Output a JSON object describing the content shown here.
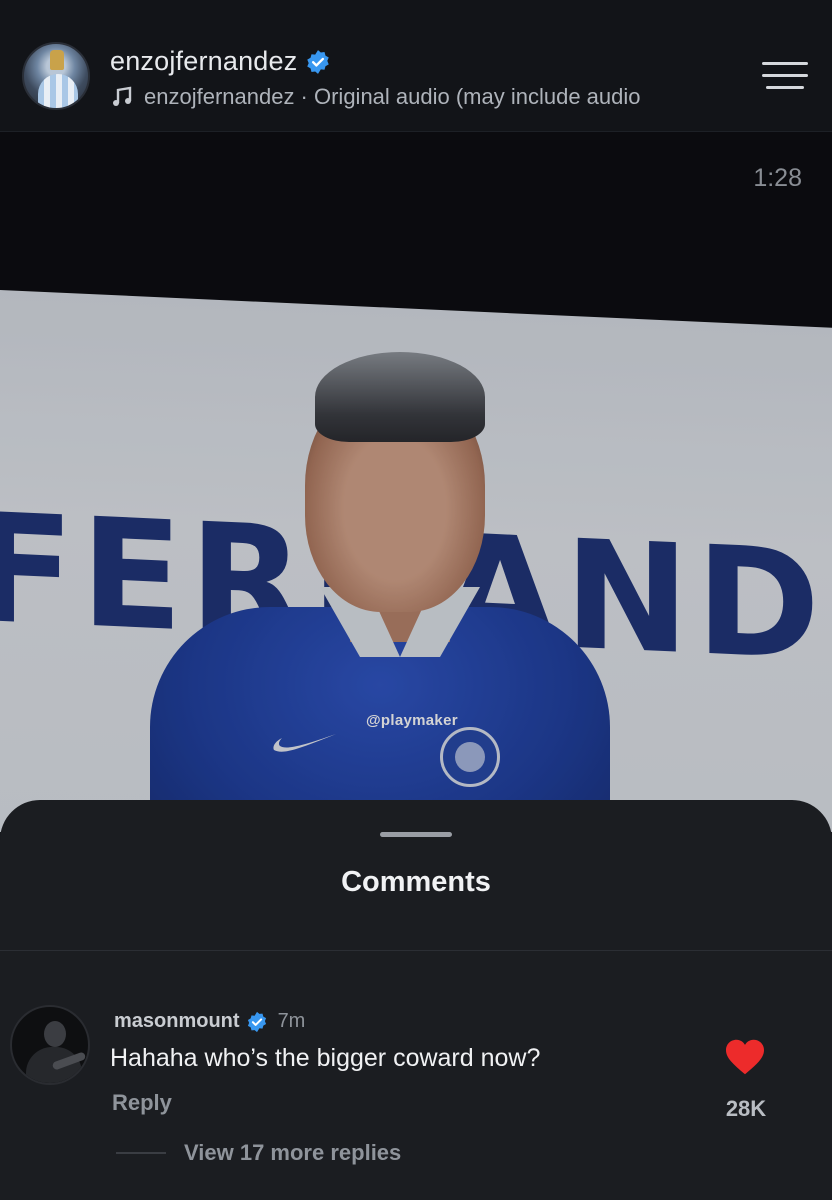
{
  "header": {
    "username": "enzojfernandez",
    "audio_text": "enzojfernandez · Original audio  (may include audio",
    "icons": {
      "verified": "verified-badge-icon",
      "audio": "music-note-icon",
      "menu": "menu-icon"
    }
  },
  "video": {
    "timestamp": "1:28",
    "banner_text": "FERNANDEZ",
    "watermark": "@playmaker"
  },
  "comments": {
    "title": "Comments",
    "items": [
      {
        "username": "masonmount",
        "time": "7m",
        "text": "Hahaha who’s the bigger coward now?",
        "reply_label": "Reply",
        "likes": "28K",
        "view_replies": "View 17 more replies"
      }
    ]
  },
  "colors": {
    "verified": "#3897f0",
    "heart": "#ed2b2b",
    "background": "#16181c",
    "sheet": "#1b1d21"
  }
}
